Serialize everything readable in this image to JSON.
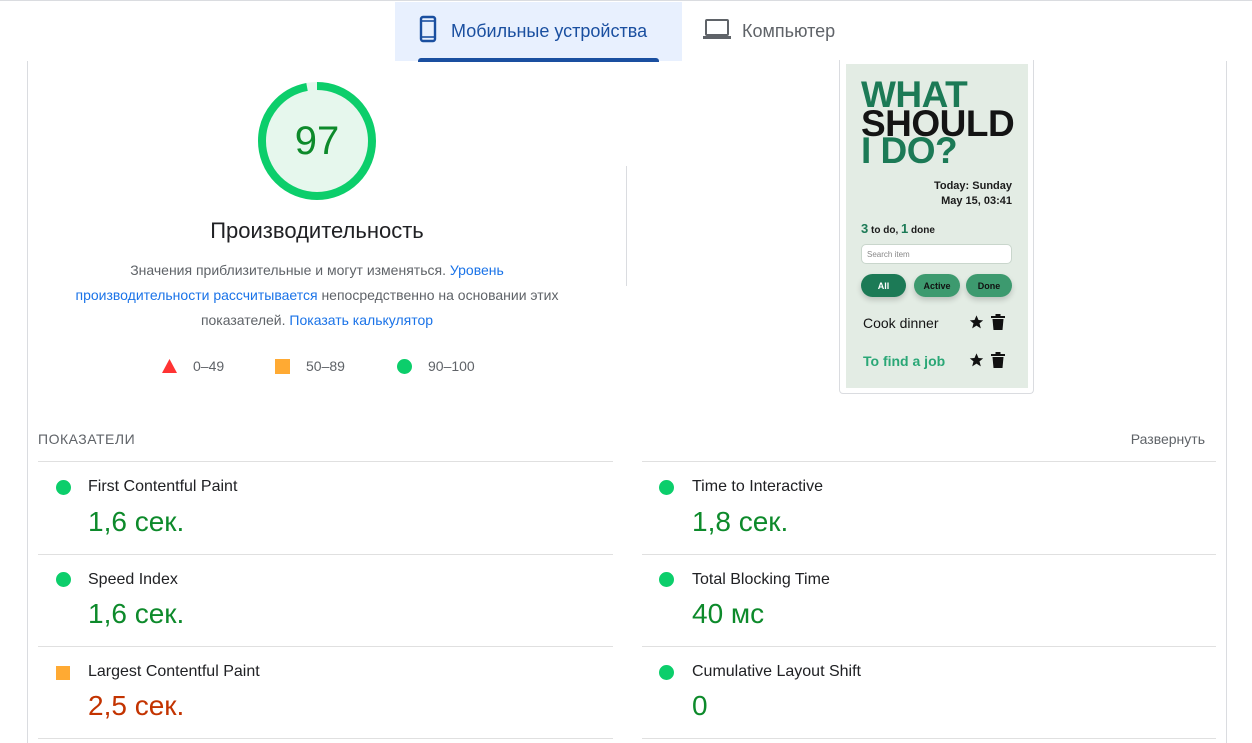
{
  "tabs": [
    {
      "label": "Мобильные устройства",
      "active": true,
      "icon": "smartphone-icon"
    },
    {
      "label": "Компьютер",
      "active": false,
      "icon": "laptop-icon"
    }
  ],
  "performance": {
    "score": "97",
    "score_fraction": 0.97,
    "title": "Производительность",
    "desc_text1": "Значения приблизительные и могут изменяться.",
    "desc_link1": "Уровень производительности рассчитывается",
    "desc_text2": "непосредственно на основании этих показателей.",
    "desc_link2": "Показать калькулятор"
  },
  "legend": [
    {
      "range": "0–49",
      "shape": "triangle",
      "color": "#ff3333"
    },
    {
      "range": "50–89",
      "shape": "square",
      "color": "#ffaa33"
    },
    {
      "range": "90–100",
      "shape": "circle",
      "color": "#0cce6b"
    }
  ],
  "preview": {
    "line1": "WHAT",
    "line2": "SHOULD",
    "line3": "I DO?",
    "date_line1": "Today: Sunday",
    "date_line2": "May 15, 03:41",
    "todo_count": "3",
    "todo_label": "to do,",
    "done_count": "1",
    "done_label": "done",
    "search_placeholder": "Search item",
    "filters": [
      "All",
      "Active",
      "Done"
    ],
    "items": [
      "Cook dinner",
      "To find a job"
    ]
  },
  "metrics": {
    "section_label": "ПОКАЗАТЕЛИ",
    "expand_label": "Развернуть",
    "items": [
      {
        "name": "First Contentful Paint",
        "value": "1,6 сек.",
        "rating": "good"
      },
      {
        "name": "Time to Interactive",
        "value": "1,8 сек.",
        "rating": "good"
      },
      {
        "name": "Speed Index",
        "value": "1,6 сек.",
        "rating": "good"
      },
      {
        "name": "Total Blocking Time",
        "value": "40 мс",
        "rating": "good"
      },
      {
        "name": "Largest Contentful Paint",
        "value": "2,5 сек.",
        "rating": "average"
      },
      {
        "name": "Cumulative Layout Shift",
        "value": "0",
        "rating": "good"
      }
    ]
  },
  "colors": {
    "good": "#0cce6b",
    "good_text": "#0d8a2b",
    "average": "#ffaa33",
    "average_text": "#c33300",
    "poor": "#ff3333",
    "link": "#1a73e8",
    "tab_active": "#1a4fa0"
  }
}
